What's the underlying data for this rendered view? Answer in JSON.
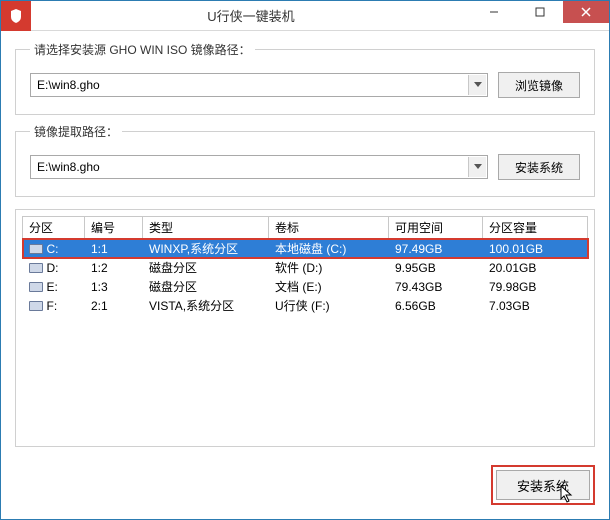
{
  "titlebar": {
    "title": "U行侠一键装机"
  },
  "source_group": {
    "legend": "请选择安装源 GHO WIN ISO 镜像路径：",
    "value": "E:\\win8.gho",
    "browse_label": "浏览镜像"
  },
  "extract_group": {
    "legend": "镜像提取路径：",
    "value": "E:\\win8.gho",
    "install_label": "安装系统"
  },
  "table": {
    "headers": {
      "partition": "分区",
      "number": "编号",
      "type": "类型",
      "label": "卷标",
      "free": "可用空间",
      "capacity": "分区容量"
    },
    "rows": [
      {
        "partition": "C:",
        "number": "1:1",
        "type": "WINXP,系统分区",
        "label": "本地磁盘 (C:)",
        "free": "97.49GB",
        "capacity": "100.01GB",
        "selected": true
      },
      {
        "partition": "D:",
        "number": "1:2",
        "type": "磁盘分区",
        "label": "软件 (D:)",
        "free": "9.95GB",
        "capacity": "20.01GB"
      },
      {
        "partition": "E:",
        "number": "1:3",
        "type": "磁盘分区",
        "label": "文档 (E:)",
        "free": "79.43GB",
        "capacity": "79.98GB"
      },
      {
        "partition": "F:",
        "number": "2:1",
        "type": "VISTA,系统分区",
        "label": "U行侠 (F:)",
        "free": "6.56GB",
        "capacity": "7.03GB"
      }
    ]
  },
  "footer": {
    "install_label": "安装系统"
  }
}
